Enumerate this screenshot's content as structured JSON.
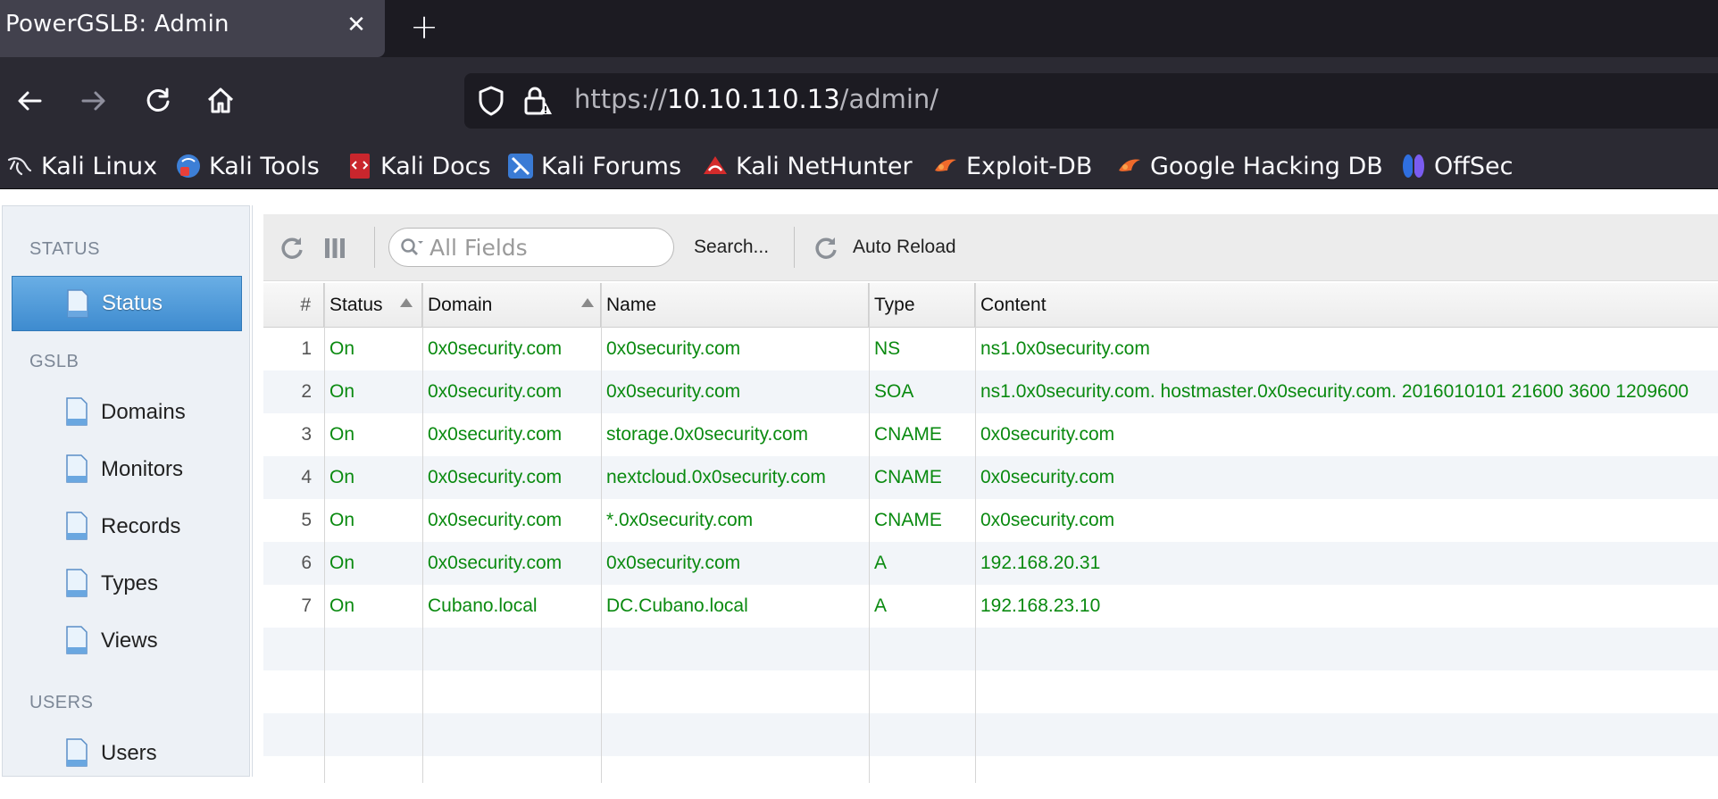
{
  "browser": {
    "tab_title": "PowerGSLB: Admin",
    "close_glyph": "✕",
    "new_tab_glyph": "+",
    "url_scheme": "https://",
    "url_host": "10.10.110.13",
    "url_path": "/admin/",
    "bookmarks": [
      {
        "label": "Kali Linux",
        "icon": "kali-dragon-icon"
      },
      {
        "label": "Kali Tools",
        "icon": "kali-tools-icon"
      },
      {
        "label": "Kali Docs",
        "icon": "kali-docs-icon"
      },
      {
        "label": "Kali Forums",
        "icon": "kali-forums-icon"
      },
      {
        "label": "Kali NetHunter",
        "icon": "kali-nethunter-icon"
      },
      {
        "label": "Exploit-DB",
        "icon": "exploit-db-icon"
      },
      {
        "label": "Google Hacking DB",
        "icon": "ghdb-icon"
      },
      {
        "label": "OffSec",
        "icon": "offsec-icon"
      }
    ]
  },
  "sidebar": {
    "groups": [
      {
        "label": "STATUS"
      },
      {
        "label": "GSLB"
      },
      {
        "label": "USERS"
      }
    ],
    "items": [
      {
        "label": "Status",
        "active": true
      },
      {
        "label": "Domains"
      },
      {
        "label": "Monitors"
      },
      {
        "label": "Records"
      },
      {
        "label": "Types"
      },
      {
        "label": "Views"
      },
      {
        "label": "Users"
      }
    ]
  },
  "toolbar": {
    "search_placeholder": "All Fields",
    "search_button": "Search...",
    "auto_reload": "Auto Reload"
  },
  "table": {
    "columns": [
      "#",
      "Status",
      "Domain",
      "Name",
      "Type",
      "Content"
    ],
    "rows": [
      {
        "n": "1",
        "status": "On",
        "domain": "0x0security.com",
        "name": "0x0security.com",
        "type": "NS",
        "content": "ns1.0x0security.com"
      },
      {
        "n": "2",
        "status": "On",
        "domain": "0x0security.com",
        "name": "0x0security.com",
        "type": "SOA",
        "content": "ns1.0x0security.com. hostmaster.0x0security.com. 2016010101 21600 3600 1209600"
      },
      {
        "n": "3",
        "status": "On",
        "domain": "0x0security.com",
        "name": "storage.0x0security.com",
        "type": "CNAME",
        "content": "0x0security.com"
      },
      {
        "n": "4",
        "status": "On",
        "domain": "0x0security.com",
        "name": "nextcloud.0x0security.com",
        "type": "CNAME",
        "content": "0x0security.com"
      },
      {
        "n": "5",
        "status": "On",
        "domain": "0x0security.com",
        "name": "*.0x0security.com",
        "type": "CNAME",
        "content": "0x0security.com"
      },
      {
        "n": "6",
        "status": "On",
        "domain": "0x0security.com",
        "name": "0x0security.com",
        "type": "A",
        "content": "192.168.20.31"
      },
      {
        "n": "7",
        "status": "On",
        "domain": "Cubano.local",
        "name": "DC.Cubano.local",
        "type": "A",
        "content": "192.168.23.10"
      }
    ]
  },
  "colors": {
    "record_text": "#0a8a10",
    "active_item": "#4a97d8"
  }
}
